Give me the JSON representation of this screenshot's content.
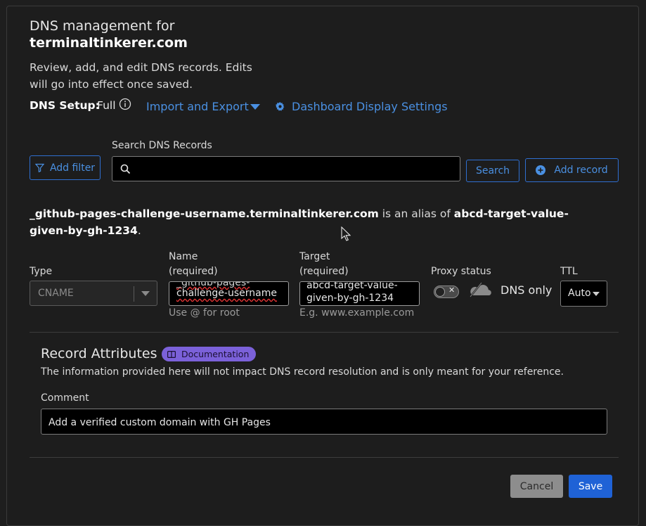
{
  "header": {
    "title_prefix": "DNS management for",
    "domain": "terminaltinkerer.com",
    "description": "Review, add, and edit DNS records. Edits will go into effect once saved."
  },
  "setup": {
    "label": "DNS Setup:",
    "value": "Full",
    "import_export_label": "Import and Export",
    "dashboard_settings_label": "Dashboard Display Settings"
  },
  "toolbar": {
    "add_filter_label": "Add filter",
    "search_label": "Search DNS Records",
    "search_value": "",
    "search_button_label": "Search",
    "add_record_label": "Add record"
  },
  "alias": {
    "source": "_github-pages-challenge-username.terminaltinkerer.com",
    "middle": " is an alias of ",
    "target": "abcd-target-value-given-by-gh-1234",
    "end": "."
  },
  "record": {
    "type_label": "Type",
    "type_value": "CNAME",
    "name_label": "Name",
    "name_required": "(required)",
    "name_value_line1": "_github-pages-",
    "name_value_line2": "challenge-username",
    "name_hint": "Use @ for root",
    "target_label": "Target",
    "target_required": "(required)",
    "target_value_line1": "abcd-target-value-",
    "target_value_line2": "given-by-gh-1234",
    "target_hint": "E.g. www.example.com",
    "proxy_label": "Proxy status",
    "proxy_toggle_symbol": "✕",
    "proxy_text": "DNS only",
    "ttl_label": "TTL",
    "ttl_value": "Auto"
  },
  "attributes": {
    "title": "Record Attributes",
    "doc_badge": "Documentation",
    "description": "The information provided here will not impact DNS record resolution and is only meant for your reference.",
    "comment_label": "Comment",
    "comment_value": "Add a verified custom domain with GH Pages"
  },
  "actions": {
    "cancel_label": "Cancel",
    "save_label": "Save"
  },
  "colors": {
    "accent": "#4a90e2",
    "primary_button": "#1f62d6",
    "badge": "#7b61d9"
  }
}
